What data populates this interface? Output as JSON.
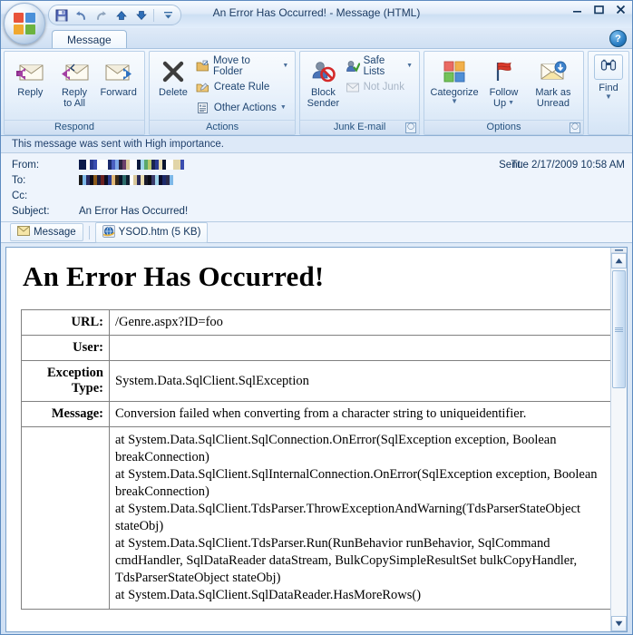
{
  "window": {
    "title": "An Error Has Occurred! - Message (HTML)",
    "minimize_label": "–",
    "maximize_label": "❐",
    "close_label": "✕",
    "help_label": "?"
  },
  "quick_access": {
    "items": [
      {
        "name": "save-icon",
        "label": "Save"
      },
      {
        "name": "undo-icon",
        "label": "Undo"
      },
      {
        "name": "redo-icon",
        "label": "Redo"
      },
      {
        "name": "previous-item-icon",
        "label": "Previous Item"
      },
      {
        "name": "next-item-icon",
        "label": "Next Item"
      }
    ],
    "customize_label": "≡"
  },
  "ribbon": {
    "tab_label": "Message",
    "groups": [
      {
        "label": "Respond",
        "buttons": [
          {
            "label_line1": "Reply",
            "label_line2": ""
          },
          {
            "label_line1": "Reply",
            "label_line2": "to All"
          },
          {
            "label_line1": "Forward",
            "label_line2": ""
          }
        ]
      },
      {
        "label": "Actions",
        "big": {
          "label_line1": "Delete",
          "label_line2": ""
        },
        "small": [
          {
            "label": "Move to Folder",
            "has_caret": true
          },
          {
            "label": "Create Rule",
            "has_caret": false
          },
          {
            "label": "Other Actions",
            "has_caret": true
          }
        ]
      },
      {
        "label": "Junk E-mail",
        "big": {
          "label_line1": "Block",
          "label_line2": "Sender"
        },
        "small": [
          {
            "label": "Safe Lists",
            "has_caret": true,
            "disabled": false
          },
          {
            "label": "Not Junk",
            "has_caret": false,
            "disabled": true
          }
        ]
      },
      {
        "label": "Options",
        "buttons": [
          {
            "label_line1": "Categorize",
            "label_line2": "",
            "caret": true
          },
          {
            "label_line1": "Follow",
            "label_line2": "Up",
            "caret": true
          },
          {
            "label_line1": "Mark as",
            "label_line2": "Unread",
            "caret": false
          }
        ]
      }
    ],
    "find": {
      "label": "Find",
      "caret": true
    }
  },
  "infobar": {
    "text": "This message was sent with High importance."
  },
  "headers": {
    "from_label": "From:",
    "to_label": "To:",
    "cc_label": "Cc:",
    "subject_label": "Subject:",
    "subject_value": "An Error Has Occurred!",
    "cc_value": "",
    "sent_label": "Sent:",
    "sent_value": "Tue 2/17/2009 10:58 AM",
    "from_redacted": [
      "#0d1b4a",
      "#0d1b4a",
      "#ffffff",
      "#2b3b8f",
      "#3a4db0",
      "#ffffff",
      "#ffffff",
      "#ffffff",
      "#1b2a6b",
      "#4a5fc0",
      "#7ea8e8",
      "#2a2340",
      "#6b3f6b",
      "#d8c79a",
      "#ffffff",
      "#ffffff",
      "#0e1a3c",
      "#9fd4ea",
      "#5aa86a",
      "#b8c96a",
      "#1a2550",
      "#2b3b8f",
      "#e8dcb0",
      "#0b1430",
      "#ffffff",
      "#ffffff",
      "#e2d5a8",
      "#e2d5a8",
      "#3a4db0"
    ],
    "to_redacted": [
      "#1b1b1b",
      "#7db8e8",
      "#2a2a60",
      "#0a0a18",
      "#8a5a1a",
      "#1a1a3a",
      "#6a2020",
      "#0d0d20",
      "#2b3b8f",
      "#e0b878",
      "#3a2a18",
      "#0a1428",
      "#2a6a6a",
      "#0f1f2f",
      "#ffffff",
      "#d8c79a",
      "#2a2a5a",
      "#e8dcb0",
      "#1a1a2a",
      "#0a0a14",
      "#3a3a6a",
      "#9fd4ea",
      "#0d0d2a",
      "#1b2a6b",
      "#2a2a4a",
      "#7db8e8"
    ]
  },
  "attachments": {
    "message_tab_label": "Message",
    "file_label": "YSOD.htm (5 KB)"
  },
  "body": {
    "heading": "An Error Has Occurred!",
    "rows": [
      {
        "label": "URL:",
        "value": "/Genre.aspx?ID=foo"
      },
      {
        "label": "User:",
        "value": ""
      },
      {
        "label": "Exception Type:",
        "value": "System.Data.SqlClient.SqlException"
      },
      {
        "label": "Message:",
        "value": "Conversion failed when converting from a character string to uniqueidentifier."
      }
    ],
    "stack_label": "",
    "stack_trace": "at System.Data.SqlClient.SqlConnection.OnError(SqlException exception, Boolean breakConnection)\nat System.Data.SqlClient.SqlInternalConnection.OnError(SqlException exception, Boolean breakConnection)\nat System.Data.SqlClient.TdsParser.ThrowExceptionAndWarning(TdsParserStateObject stateObj)\nat System.Data.SqlClient.TdsParser.Run(RunBehavior runBehavior, SqlCommand cmdHandler, SqlDataReader dataStream, BulkCopySimpleResultSet bulkCopyHandler, TdsParserStateObject stateObj)\nat System.Data.SqlClient.SqlDataReader.HasMoreRows()"
  },
  "colors": {
    "accent": "#1e4470",
    "ribbon_bg": "#e3eefa",
    "pane_bg": "#ffffff",
    "title_text": "#1d3c63"
  }
}
